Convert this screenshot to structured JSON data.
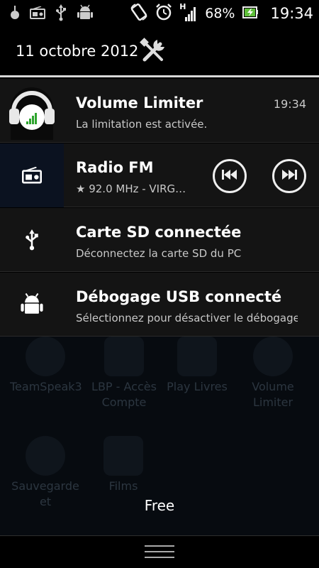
{
  "status_bar": {
    "icons_left": [
      "bug-icon",
      "radio-icon",
      "usb-icon",
      "android-icon"
    ],
    "icons_right": [
      "rotate-icon",
      "alarm-icon",
      "signal-icon",
      "battery-icon"
    ],
    "network_type": "H",
    "battery_percent": "68%",
    "time": "19:34"
  },
  "header": {
    "date": "11 octobre 2012",
    "settings_icon": "tools-icon"
  },
  "notifications": [
    {
      "title": "Volume Limiter",
      "subtitle": "La limitation est activée.",
      "time": "19:34",
      "icon": "volume-limiter-icon"
    },
    {
      "title": "Radio FM",
      "subtitle": "★ 92.0 MHz - VIRG…",
      "icon": "radio-icon",
      "controls": [
        "previous-icon",
        "next-icon"
      ]
    },
    {
      "title": "Carte SD connectée",
      "subtitle": "Déconnectez la carte SD du PC",
      "icon": "usb-icon"
    },
    {
      "title": "Débogage USB connecté",
      "subtitle": "Sélectionnez pour désactiver le débogage USB",
      "icon": "android-icon"
    }
  ],
  "home_apps": [
    {
      "label": "TeamSpeak3"
    },
    {
      "label": "LBP - Accès Compte"
    },
    {
      "label": "Play Livres"
    },
    {
      "label": "Volume Limiter"
    },
    {
      "label": "Sauvegarde et"
    },
    {
      "label": "Films"
    }
  ],
  "carrier": "Free",
  "colors": {
    "background": "#000000",
    "notification_bg": "#141414",
    "signal_green": "#2fa52f"
  }
}
